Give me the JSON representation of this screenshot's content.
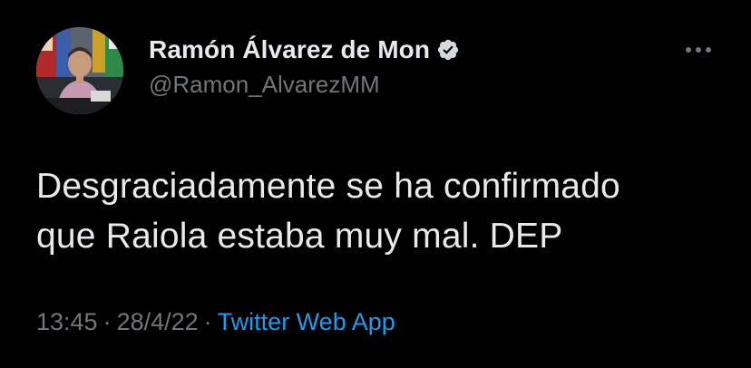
{
  "user": {
    "display_name": "Ramón Álvarez de Mon",
    "handle": "@Ramon_AlvarezMM",
    "verified": true,
    "avatar_icon": "profile-photo"
  },
  "tweet": {
    "text_line1": "Desgraciadamente se ha confirmado",
    "text_line2": "que Raiola estaba muy mal. DEP",
    "time": "13:45",
    "date": "28/4/22",
    "separator": "·",
    "source": "Twitter Web App"
  },
  "icons": {
    "more": "more-horizontal-icon",
    "verified": "verified-badge-icon"
  },
  "colors": {
    "background": "#000000",
    "text": "#e7e9ea",
    "muted": "#71767b",
    "link": "#1d9bf0"
  }
}
